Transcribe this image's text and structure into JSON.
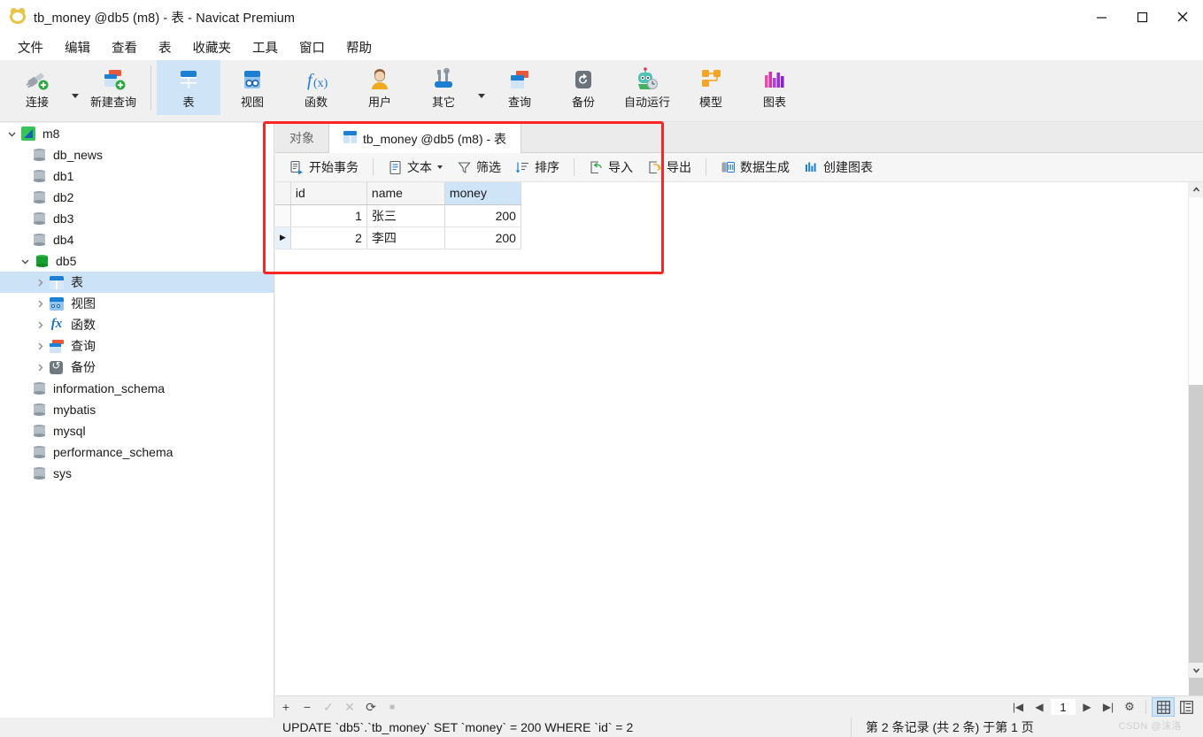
{
  "window": {
    "title": "tb_money @db5 (m8) - 表 - Navicat Premium",
    "app_icon": "navicat-icon",
    "minimize": "−",
    "maximize": "▢",
    "close": "✕"
  },
  "menubar": {
    "items": [
      {
        "label": "文件",
        "name": "menu-file"
      },
      {
        "label": "编辑",
        "name": "menu-edit"
      },
      {
        "label": "查看",
        "name": "menu-view"
      },
      {
        "label": "表",
        "name": "menu-table"
      },
      {
        "label": "收藏夹",
        "name": "menu-favorites"
      },
      {
        "label": "工具",
        "name": "menu-tools"
      },
      {
        "label": "窗口",
        "name": "menu-window"
      },
      {
        "label": "帮助",
        "name": "menu-help"
      }
    ]
  },
  "toolbar": {
    "buttons": [
      {
        "label": "连接",
        "icon": "connection-icon",
        "active": false
      },
      {
        "label": "新建查询",
        "icon": "new-query-icon",
        "active": false
      },
      {
        "label": "表",
        "icon": "table-icon",
        "active": true
      },
      {
        "label": "视图",
        "icon": "view-icon",
        "active": false
      },
      {
        "label": "函数",
        "icon": "function-icon",
        "active": false
      },
      {
        "label": "用户",
        "icon": "user-icon",
        "active": false
      },
      {
        "label": "其它",
        "icon": "other-tools-icon",
        "active": false
      },
      {
        "label": "查询",
        "icon": "query-icon",
        "active": false
      },
      {
        "label": "备份",
        "icon": "backup-icon",
        "active": false
      },
      {
        "label": "自动运行",
        "icon": "automation-icon",
        "active": false
      },
      {
        "label": "模型",
        "icon": "model-icon",
        "active": false
      },
      {
        "label": "图表",
        "icon": "chart-icon",
        "active": false
      }
    ],
    "avatar": "user-avatar"
  },
  "sidebar": {
    "tree": [
      {
        "label": "m8",
        "icon": "connection-icon",
        "indent": 0,
        "twisty": "down",
        "selected": false
      },
      {
        "label": "db_news",
        "icon": "database-icon",
        "indent": 1,
        "twisty": "none",
        "selected": false
      },
      {
        "label": "db1",
        "icon": "database-icon",
        "indent": 1,
        "twisty": "none",
        "selected": false
      },
      {
        "label": "db2",
        "icon": "database-icon",
        "indent": 1,
        "twisty": "none",
        "selected": false
      },
      {
        "label": "db3",
        "icon": "database-icon",
        "indent": 1,
        "twisty": "none",
        "selected": false
      },
      {
        "label": "db4",
        "icon": "database-icon",
        "indent": 1,
        "twisty": "none",
        "selected": false
      },
      {
        "label": "db5",
        "icon": "database-open-icon",
        "indent": 1,
        "twisty": "down",
        "selected": false
      },
      {
        "label": "表",
        "icon": "tables-folder-icon",
        "indent": 2,
        "twisty": "right",
        "selected": true
      },
      {
        "label": "视图",
        "icon": "views-folder-icon",
        "indent": 2,
        "twisty": "right",
        "selected": false
      },
      {
        "label": "函数",
        "icon": "functions-folder-icon",
        "indent": 2,
        "twisty": "right",
        "selected": false
      },
      {
        "label": "查询",
        "icon": "queries-folder-icon",
        "indent": 2,
        "twisty": "right",
        "selected": false
      },
      {
        "label": "备份",
        "icon": "backups-folder-icon",
        "indent": 2,
        "twisty": "right",
        "selected": false
      },
      {
        "label": "information_schema",
        "icon": "database-icon",
        "indent": 1,
        "twisty": "none",
        "selected": false
      },
      {
        "label": "mybatis",
        "icon": "database-icon",
        "indent": 1,
        "twisty": "none",
        "selected": false
      },
      {
        "label": "mysql",
        "icon": "database-icon",
        "indent": 1,
        "twisty": "none",
        "selected": false
      },
      {
        "label": "performance_schema",
        "icon": "database-icon",
        "indent": 1,
        "twisty": "none",
        "selected": false
      },
      {
        "label": "sys",
        "icon": "database-icon",
        "indent": 1,
        "twisty": "none",
        "selected": false
      }
    ]
  },
  "tabs": [
    {
      "label": "对象",
      "active": false,
      "icon": "none"
    },
    {
      "label": "tb_money @db5 (m8) - 表",
      "active": true,
      "icon": "table-icon"
    }
  ],
  "grid_toolbar": {
    "buttons": [
      {
        "label": "开始事务",
        "icon": "transaction-icon",
        "caret": false
      },
      {
        "label": "文本",
        "icon": "text-icon",
        "caret": true
      },
      {
        "label": "筛选",
        "icon": "filter-icon",
        "caret": false
      },
      {
        "label": "排序",
        "icon": "sort-icon",
        "caret": false
      },
      {
        "label": "导入",
        "icon": "import-icon",
        "caret": false
      },
      {
        "label": "导出",
        "icon": "export-icon",
        "caret": false
      },
      {
        "label": "数据生成",
        "icon": "data-generation-icon",
        "caret": false
      },
      {
        "label": "创建图表",
        "icon": "create-chart-icon",
        "caret": false
      }
    ]
  },
  "grid": {
    "columns": [
      "id",
      "name",
      "money"
    ],
    "selected_column": "money",
    "rows": [
      {
        "marker": "",
        "id": "1",
        "name": "张三",
        "money": "200",
        "current": false
      },
      {
        "marker": "▶",
        "id": "2",
        "name": "李四",
        "money": "200",
        "current": true
      }
    ]
  },
  "record_nav": {
    "add": "+",
    "remove": "−",
    "confirm": "✓",
    "cancel": "✕",
    "refresh": "⟳",
    "stop": "■",
    "first": "|◀",
    "prev": "◀",
    "page_value": "1",
    "next": "▶",
    "last": "▶|",
    "settings": "⚙",
    "grid_view": "grid-view-icon",
    "form_view": "form-view-icon"
  },
  "statusbar": {
    "sql": "UPDATE `db5`.`tb_money` SET `money` = 200 WHERE `id` = 2",
    "record_info": "第 2 条记录 (共 2 条) 于第 1 页",
    "watermark": "CSDN @沫洛"
  },
  "annotation": {
    "color": "#fb2525",
    "name": "red-highlight-rectangle"
  }
}
